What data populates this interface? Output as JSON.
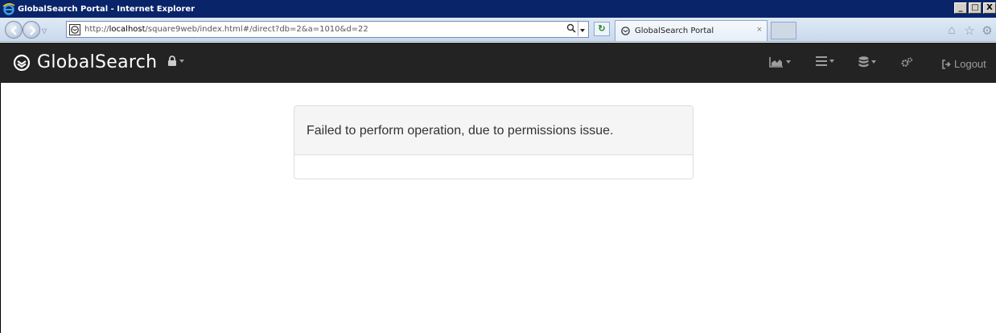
{
  "window": {
    "title": "GlobalSearch Portal - Internet Explorer",
    "controls": {
      "minimize": "_",
      "maximize": "□",
      "close": "X"
    }
  },
  "browser": {
    "url_prefix": "http://",
    "url_host": "localhost",
    "url_path": "/square9web/index.html#/direct?db=2&a=1010&d=22",
    "tab": {
      "label": "GlobalSearch Portal",
      "close": "×"
    },
    "refresh_glyph": "↻"
  },
  "app": {
    "brand": "GlobalSearch",
    "nav": {
      "logout_label": "Logout"
    }
  },
  "alert": {
    "message": "Failed to perform operation, due to permissions issue."
  },
  "colors": {
    "navbar_bg": "#232323",
    "navbar_icon": "#9d9d9d",
    "panel_heading_bg": "#f5f5f5",
    "panel_border": "#dddddd"
  },
  "icons": {
    "brand": "globalsearch-logo-icon",
    "lock": "lock-icon",
    "reports": "area-chart-icon",
    "list": "list-icon",
    "database": "database-icon",
    "settings": "cogs-icon",
    "logout": "sign-out-icon"
  }
}
